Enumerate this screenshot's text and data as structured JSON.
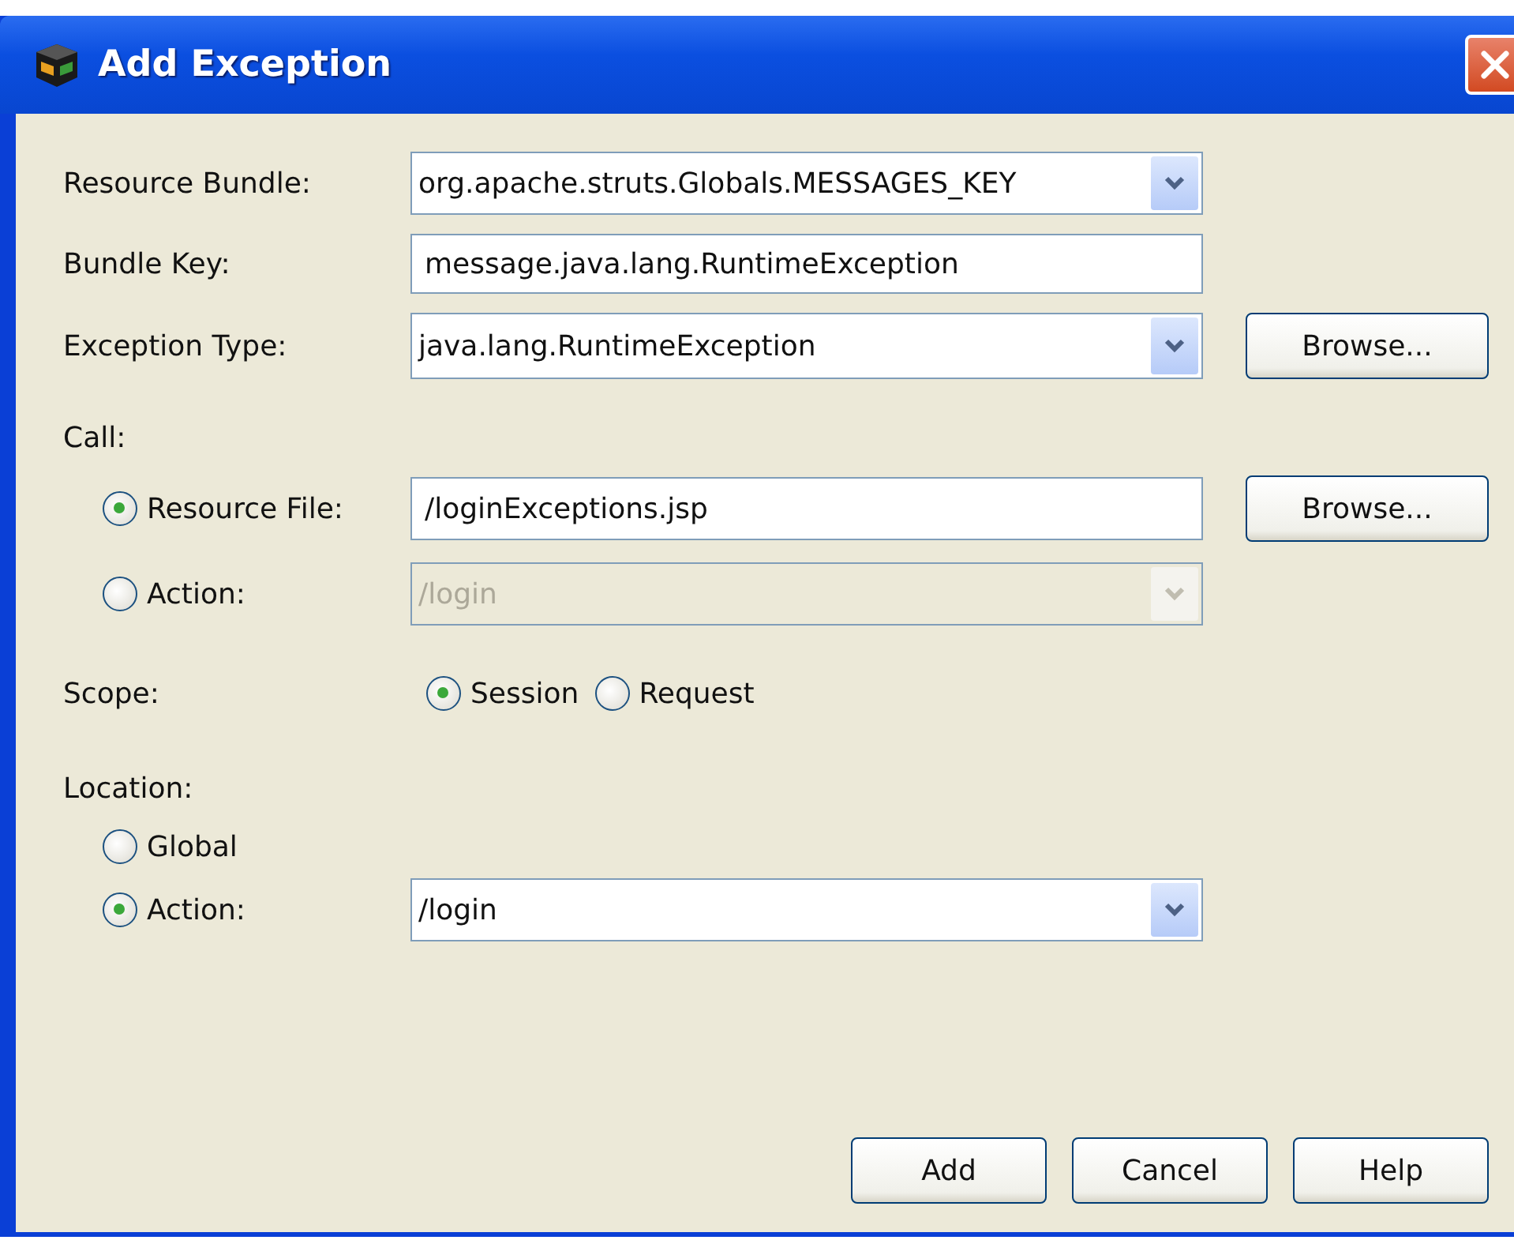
{
  "window": {
    "title": "Add Exception"
  },
  "resource_bundle": {
    "label": "Resource Bundle:",
    "kind": "combo",
    "value": "org.apache.struts.Globals.MESSAGES_KEY"
  },
  "bundle_key": {
    "label": "Bundle Key:",
    "kind": "text",
    "value": "message.java.lang.RuntimeException"
  },
  "exception_type": {
    "label": "Exception Type:",
    "kind": "combo",
    "value": "java.lang.RuntimeException",
    "button": "Browse..."
  },
  "call": {
    "label": "Call:",
    "options": [
      {
        "label": "Resource File:",
        "selected": true,
        "kind": "text",
        "value": "/loginExceptions.jsp",
        "disabled": false,
        "button": "Browse..."
      },
      {
        "label": "Action:",
        "selected": false,
        "kind": "combo",
        "value": "/login",
        "disabled": true
      }
    ]
  },
  "scope": {
    "label": "Scope:",
    "options": [
      {
        "label": "Session",
        "selected": true
      },
      {
        "label": "Request",
        "selected": false
      }
    ]
  },
  "location": {
    "label": "Location:",
    "options": [
      {
        "label": "Global",
        "selected": false
      },
      {
        "label": "Action:",
        "selected": true,
        "kind": "combo",
        "value": "/login",
        "disabled": false
      }
    ]
  },
  "buttons": [
    "Add",
    "Cancel",
    "Help"
  ]
}
